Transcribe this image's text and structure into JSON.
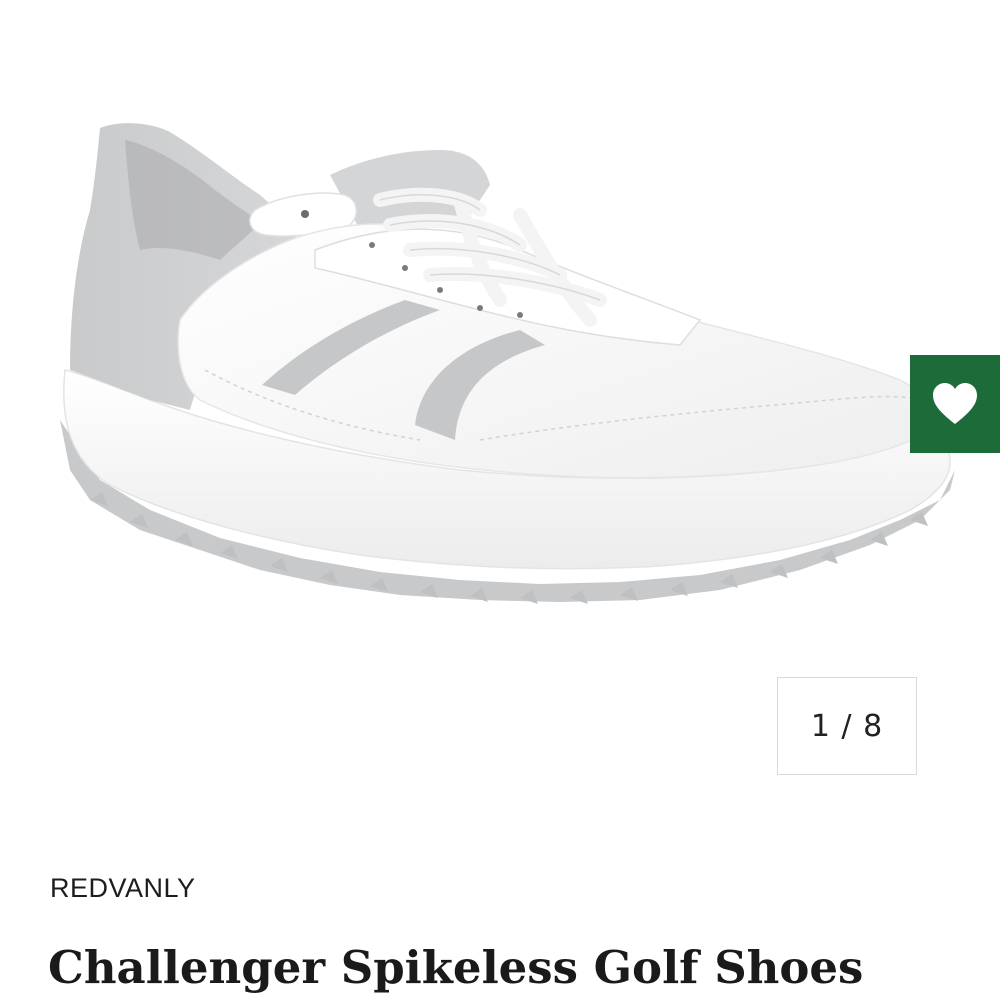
{
  "gallery": {
    "image_alt": "White and grey Challenger spikeless golf shoe",
    "counter": "1 / 8",
    "wishlist_icon": "heart-icon"
  },
  "product": {
    "brand": "REDVANLY",
    "title": "Challenger Spikeless Golf Shoes"
  },
  "colors": {
    "wishlist_bg": "#1e6b3a",
    "shoe_white": "#f7f7f7",
    "shoe_grey": "#cfd0d1",
    "outsole_grey": "#c5c6c7"
  }
}
